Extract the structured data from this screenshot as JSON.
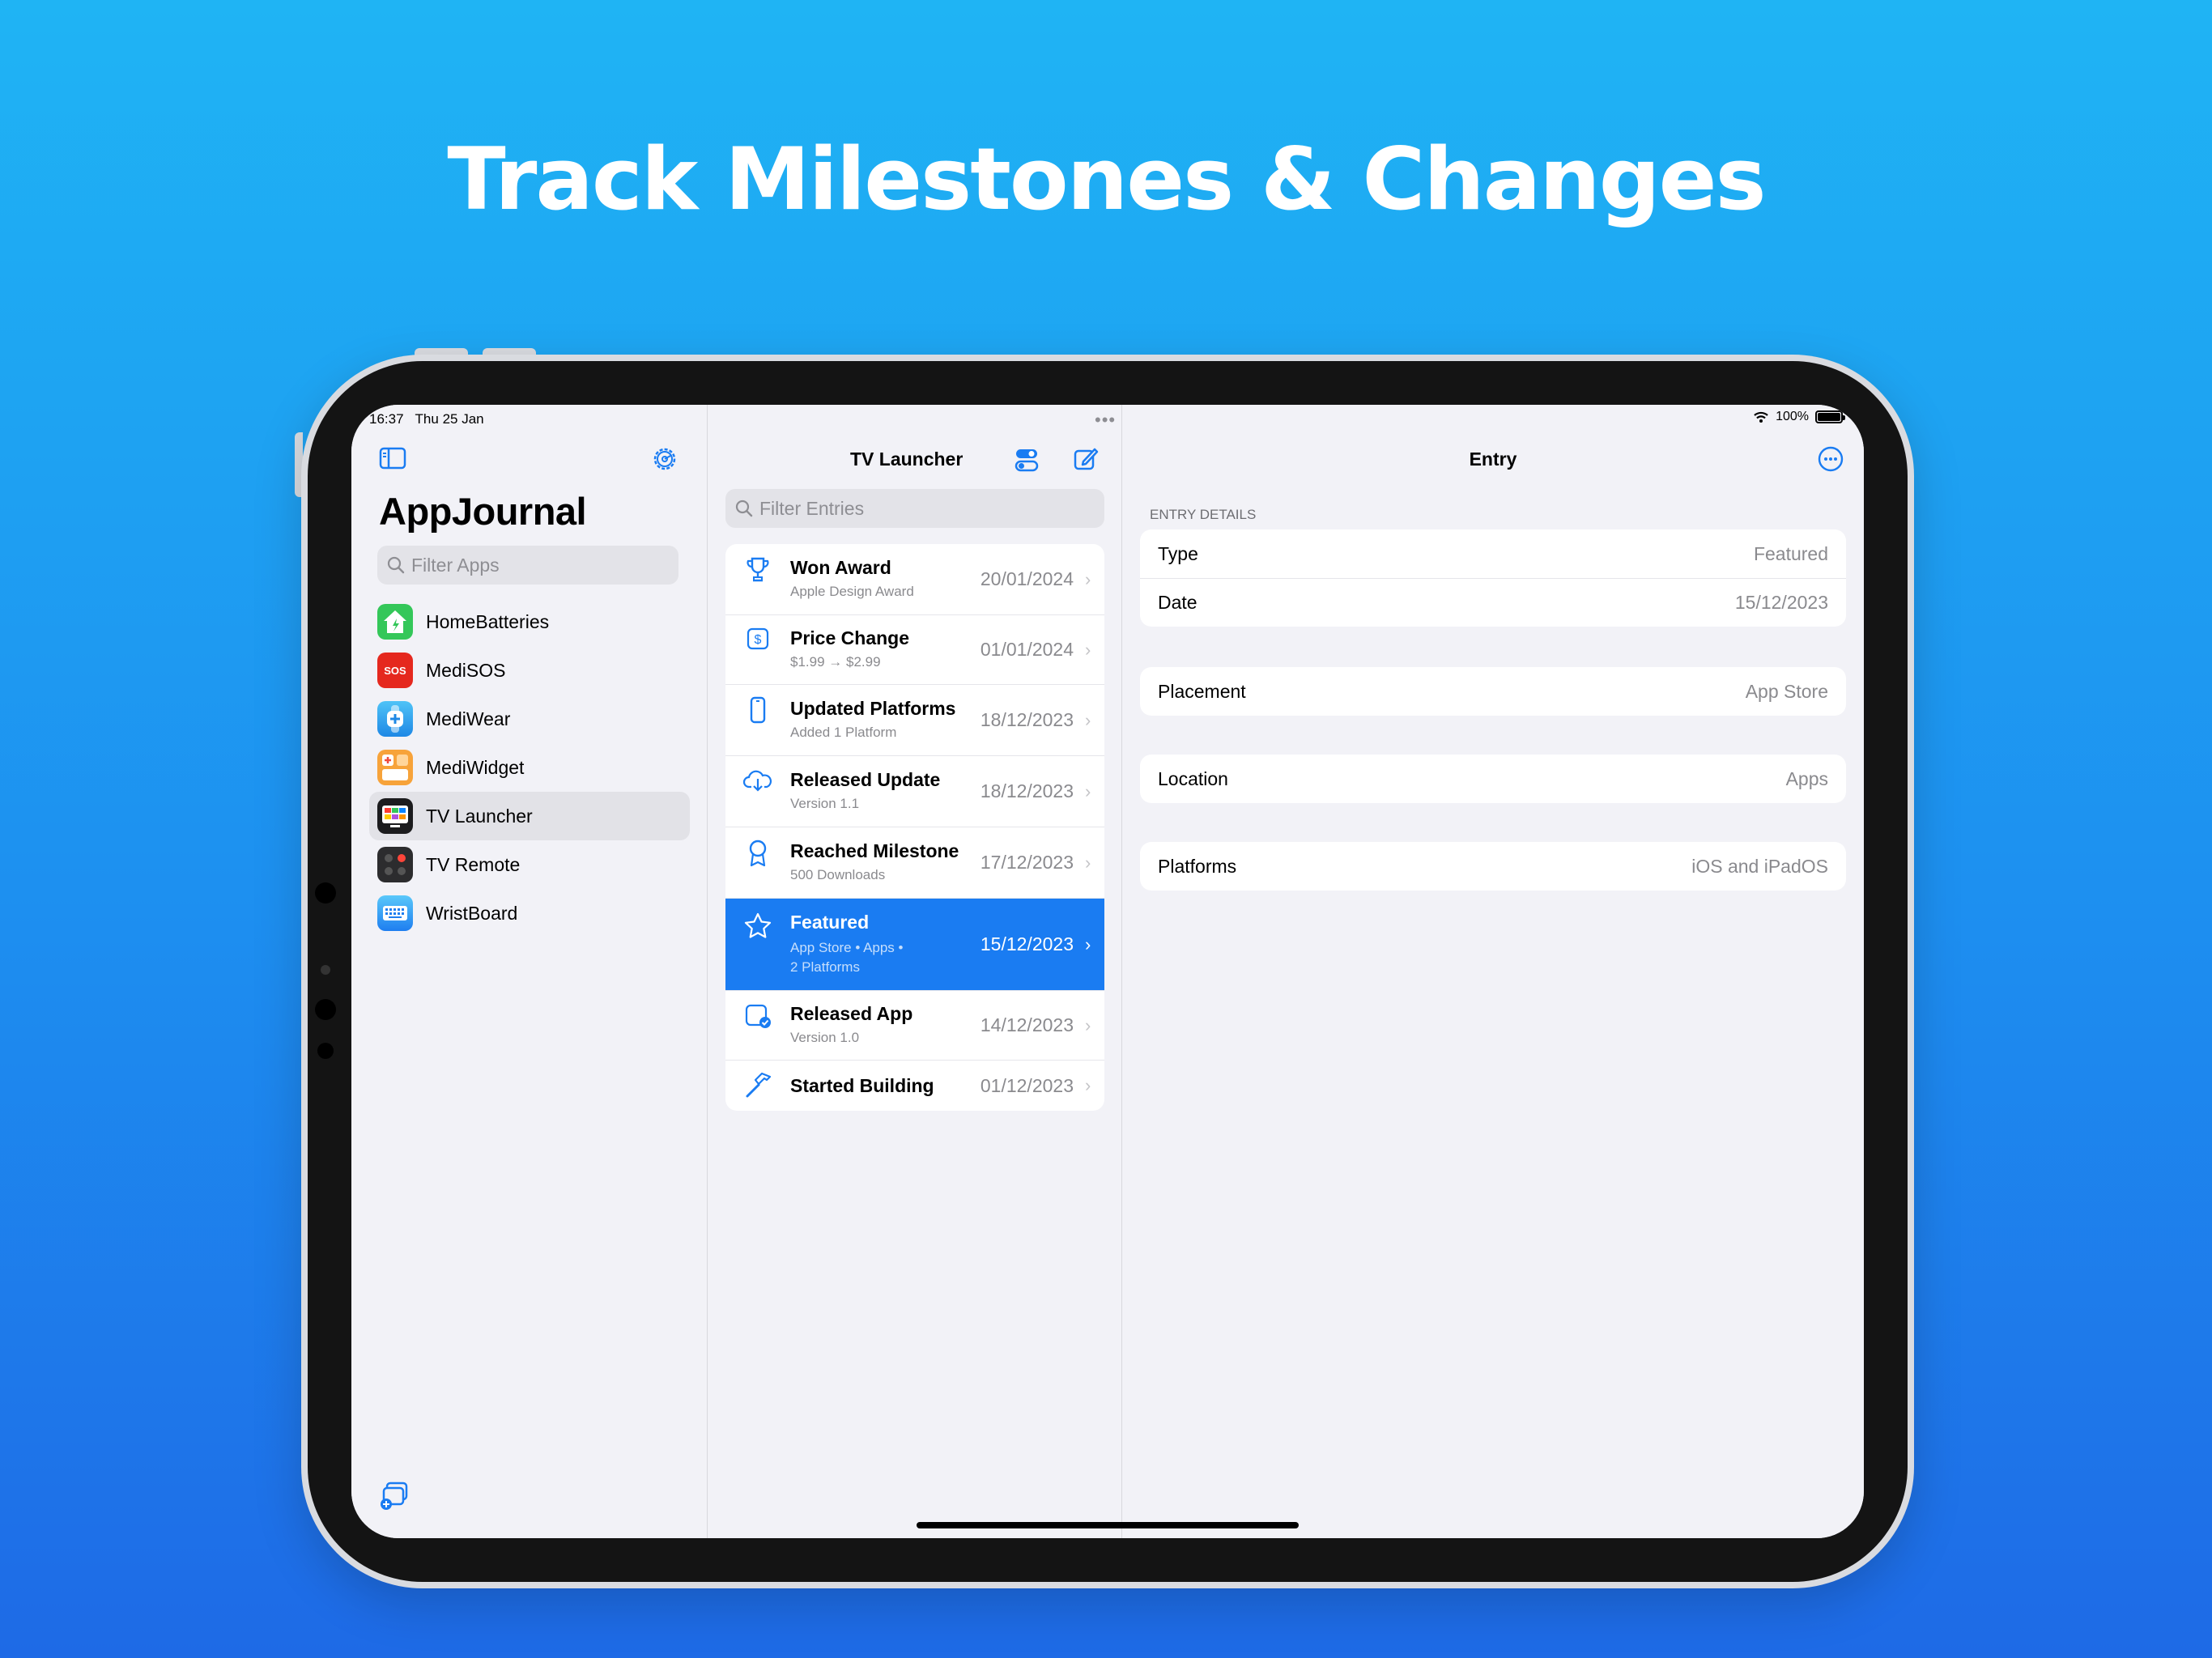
{
  "headline": "Track Milestones & Changes",
  "status_bar": {
    "time": "16:37",
    "date": "Thu 25 Jan",
    "battery": "100%",
    "multitask_dots": "•••"
  },
  "sidebar": {
    "title": "AppJournal",
    "search_placeholder": "Filter Apps",
    "apps": [
      {
        "name": "HomeBatteries",
        "icon": "home-batteries-icon",
        "color": "#34c759"
      },
      {
        "name": "MediSOS",
        "icon": "medisos-icon",
        "color": "#e5281e",
        "badge": "SOS"
      },
      {
        "name": "MediWear",
        "icon": "mediwear-icon",
        "color": "#2aa8f2"
      },
      {
        "name": "MediWidget",
        "icon": "mediwidget-icon",
        "color": "#f7a33a"
      },
      {
        "name": "TV Launcher",
        "icon": "tv-launcher-icon",
        "color": "#1c1c1e",
        "selected": true
      },
      {
        "name": "TV Remote",
        "icon": "tv-remote-icon",
        "color": "#2c2c2e"
      },
      {
        "name": "WristBoard",
        "icon": "wristboard-icon",
        "color": "#2e8df5"
      }
    ]
  },
  "middle": {
    "title": "TV Launcher",
    "search_placeholder": "Filter Entries",
    "entries": [
      {
        "title": "Won Award",
        "subtitle": [
          "Apple Design Award"
        ],
        "date": "20/01/2024",
        "icon": "trophy-icon"
      },
      {
        "title": "Price Change",
        "subtitle": [
          "$1.99 → $2.99"
        ],
        "date": "01/01/2024",
        "icon": "dollar-icon"
      },
      {
        "title": "Updated Platforms",
        "subtitle": [
          "Added 1 Platform"
        ],
        "date": "18/12/2023",
        "icon": "phone-icon"
      },
      {
        "title": "Released Update",
        "subtitle": [
          "Version 1.1"
        ],
        "date": "18/12/2023",
        "icon": "cloud-download-icon"
      },
      {
        "title": "Reached Milestone",
        "subtitle": [
          "500 Downloads"
        ],
        "date": "17/12/2023",
        "icon": "ribbon-icon"
      },
      {
        "title": "Featured",
        "subtitle": [
          "App Store • Apps •",
          "2 Platforms"
        ],
        "date": "15/12/2023",
        "icon": "star-icon",
        "selected": true
      },
      {
        "title": "Released App",
        "subtitle": [
          "Version 1.0"
        ],
        "date": "14/12/2023",
        "icon": "app-check-icon"
      },
      {
        "title": "Started Building",
        "subtitle": [],
        "date": "01/12/2023",
        "icon": "hammer-icon"
      }
    ]
  },
  "detail": {
    "title": "Entry",
    "section_header": "ENTRY DETAILS",
    "group1": [
      {
        "label": "Type",
        "value": "Featured"
      },
      {
        "label": "Date",
        "value": "15/12/2023"
      }
    ],
    "placement": {
      "label": "Placement",
      "value": "App Store"
    },
    "location": {
      "label": "Location",
      "value": "Apps"
    },
    "platforms": {
      "label": "Platforms",
      "value": "iOS and iPadOS"
    }
  },
  "colors": {
    "accent": "#1a7cf2",
    "selected_row": "#1a7cf2",
    "background_top": "#1fb4f4",
    "background_bottom": "#1e6ae6"
  }
}
